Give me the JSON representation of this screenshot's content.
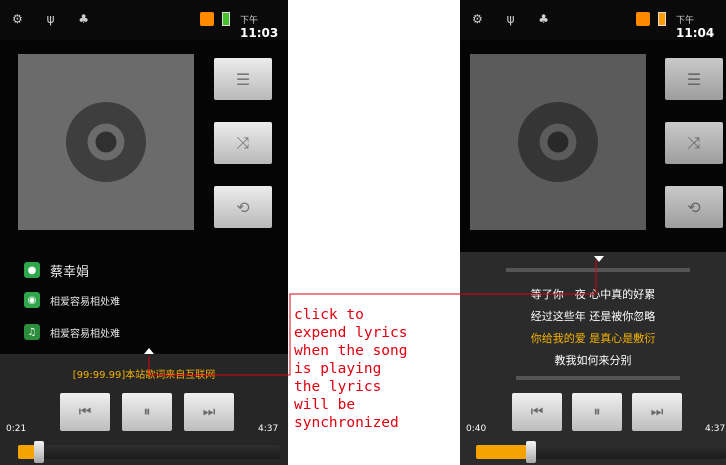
{
  "left_phone": {
    "status": {
      "clock_prefix": "下午",
      "clock": "11:03"
    },
    "side_buttons": [
      {
        "name": "playlist-icon",
        "glyph": "☰"
      },
      {
        "name": "shuffle-icon",
        "glyph": "⤨"
      },
      {
        "name": "repeat-icon",
        "glyph": "⟲"
      }
    ],
    "artist": "蔡幸娟",
    "album": "相爱容易相处难",
    "song": "相爱容易相处难",
    "lyric_line": "[99:99.99]本站歌词来自互联网",
    "elapsed": "0:21",
    "duration": "4:37",
    "progress": 0.06,
    "controls": {
      "prev": "⏮",
      "pause": "⏸",
      "next": "⏭"
    }
  },
  "right_phone": {
    "status": {
      "clock_prefix": "下午",
      "clock": "11:04"
    },
    "lyrics": [
      {
        "text": "等了你一夜   心中真的好累",
        "highlight": false
      },
      {
        "text": "经过这些年   还是被你忽略",
        "highlight": false
      },
      {
        "text": "你给我的爱   是真心是敷衍",
        "highlight": true
      },
      {
        "text": "教我如何来分别",
        "highlight": false
      }
    ],
    "elapsed": "0:40",
    "duration": "4:37",
    "progress": 0.2,
    "controls": {
      "prev": "⏮",
      "pause": "⏸",
      "next": "⏭"
    }
  },
  "annotation": "click to\nexpend lyrics\nwhen the song\nis playing\nthe lyrics\nwill be\nsynchronized",
  "colors": {
    "accent": "#f4a300",
    "lyric_highlight": "#f6b400",
    "annotation": "#e0000f"
  }
}
